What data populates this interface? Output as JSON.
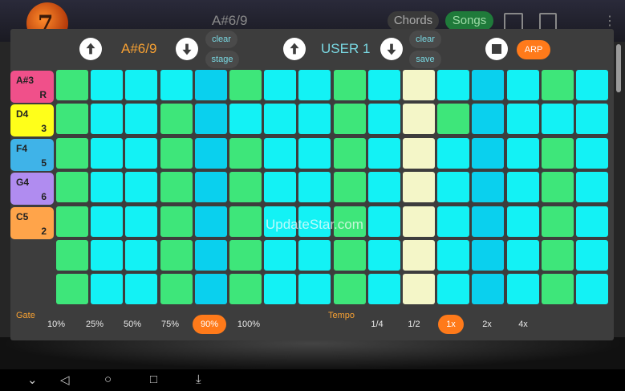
{
  "background": {
    "title": "A#6/9",
    "chords_tab": "Chords",
    "songs_tab": "Songs",
    "logo_text": "7"
  },
  "dialog": {
    "chord_name": "A#6/9",
    "clear_left": "clear",
    "stage": "stage",
    "user_name": "USER 1",
    "clear_right": "clear",
    "save": "save",
    "arp": "ARP"
  },
  "notes": [
    {
      "name": "A#3",
      "degree": "R",
      "color": "#f0508a"
    },
    {
      "name": "D4",
      "degree": "3",
      "color": "#ffff1a"
    },
    {
      "name": "F4",
      "degree": "5",
      "color": "#3fb3e8"
    },
    {
      "name": "G4",
      "degree": "6",
      "color": "#b08cf0"
    },
    {
      "name": "C5",
      "degree": "2",
      "color": "#ffa44a"
    }
  ],
  "grid": {
    "rows": 7,
    "cols": 16,
    "colors": {
      "green": "#3ee67a",
      "cyan": "#13f2f5",
      "blue": "#0ad0ee",
      "cream": "#f4f6c8"
    },
    "col_colors": [
      "green",
      "cyan",
      "cyan",
      "green",
      "blue",
      "green",
      "cyan",
      "cyan",
      "green",
      "cyan",
      "cream",
      "cyan",
      "blue",
      "cyan",
      "green",
      "cyan"
    ],
    "row0_colors": [
      "green",
      "cyan",
      "cyan",
      "cyan",
      "blue",
      "green",
      "cyan",
      "cyan",
      "green",
      "cyan",
      "cream",
      "cyan",
      "blue",
      "cyan",
      "green",
      "cyan"
    ],
    "row1_colors": [
      "green",
      "cyan",
      "cyan",
      "green",
      "blue",
      "cyan",
      "cyan",
      "cyan",
      "green",
      "cyan",
      "cream",
      "green",
      "blue",
      "cyan",
      "cyan",
      "cyan"
    ]
  },
  "gate": {
    "label": "Gate",
    "options": [
      "10%",
      "25%",
      "50%",
      "75%",
      "90%",
      "100%"
    ],
    "selected": "90%"
  },
  "tempo": {
    "label": "Tempo",
    "options": [
      "1/4",
      "1/2",
      "1x",
      "2x",
      "4x"
    ],
    "selected": "1x"
  },
  "watermark": "UpdateStar.com",
  "navbar": {
    "icons": [
      "chevron-down-icon",
      "back-icon",
      "home-icon",
      "recents-icon",
      "download-icon"
    ]
  }
}
